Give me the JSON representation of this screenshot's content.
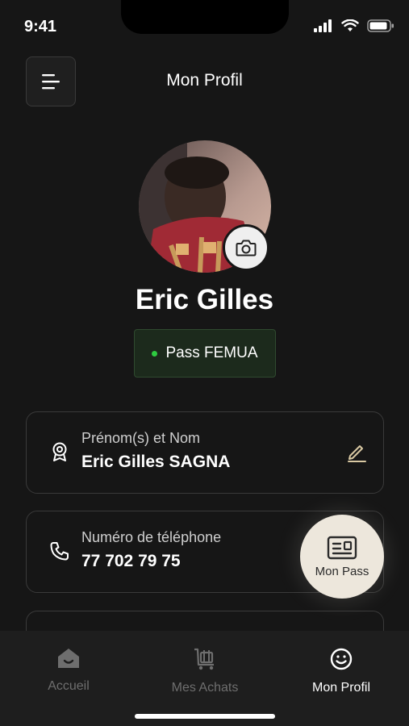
{
  "status_bar": {
    "time": "9:41"
  },
  "header": {
    "title": "Mon Profil"
  },
  "profile": {
    "name": "Eric Gilles",
    "pass_label": "Pass FEMUA",
    "pass_status_color": "#2ecc40"
  },
  "cards": [
    {
      "label": "Prénom(s) et Nom",
      "value": "Eric Gilles SAGNA",
      "icon": "award-icon",
      "action_icon": "edit-icon"
    },
    {
      "label": "Numéro de téléphone",
      "value": "77 702 79 75",
      "icon": "phone-icon"
    }
  ],
  "fab": {
    "label": "Mon Pass",
    "icon": "id-card-icon"
  },
  "nav": {
    "items": [
      {
        "label": "Accueil",
        "icon": "home-icon",
        "active": false
      },
      {
        "label": "Mes Achats",
        "icon": "cart-icon",
        "active": false
      },
      {
        "label": "Mon Profil",
        "icon": "profile-icon",
        "active": true
      }
    ]
  },
  "colors": {
    "background": "#161616",
    "accent": "#ede7dc",
    "edit_icon": "#d9c9a3"
  }
}
